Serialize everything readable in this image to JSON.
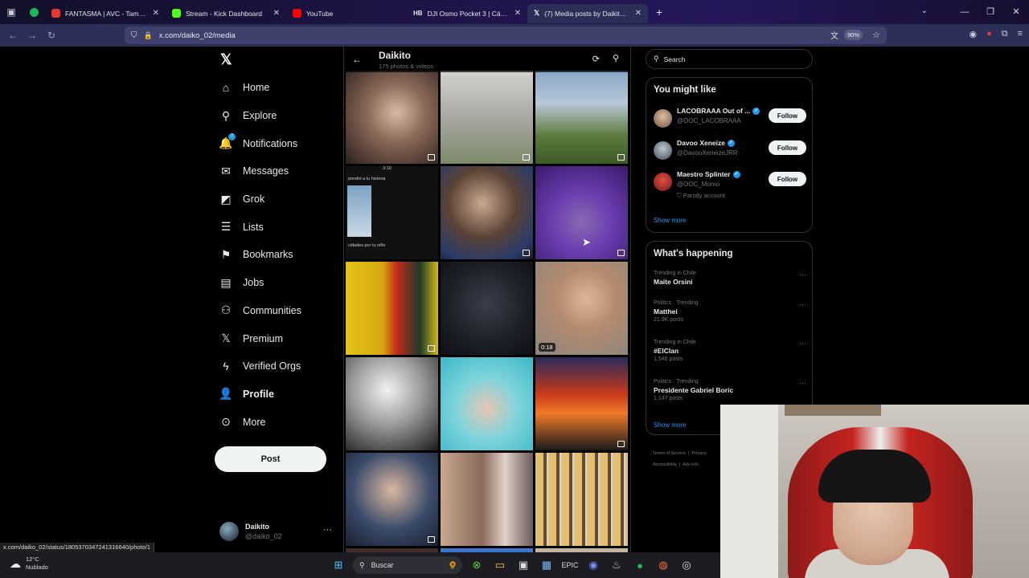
{
  "browser": {
    "tabs": [
      {
        "title": "FANTASMA | AVC - Tamy, Ji",
        "favicon_color": "#e53935"
      },
      {
        "title": "Stream - Kick Dashboard",
        "favicon_color": "#53fc18"
      },
      {
        "title": "YouTube",
        "favicon_color": "#ff0000"
      },
      {
        "title": "DJI Osmo Pocket 3 | Cámara de",
        "favicon_color": "#111111"
      },
      {
        "title": "(7) Media posts by Daikito (@da",
        "favicon_color": "#000000"
      }
    ],
    "tab_prefix_hb": "HB",
    "url": "x.com/daiko_02/media",
    "zoom": "90%"
  },
  "left_nav": {
    "items": [
      {
        "label": "Home",
        "icon": "home-icon",
        "glyph": "⌂"
      },
      {
        "label": "Explore",
        "icon": "search-icon",
        "glyph": "⚲"
      },
      {
        "label": "Notifications",
        "icon": "bell-icon",
        "glyph": "🔔"
      },
      {
        "label": "Messages",
        "icon": "mail-icon",
        "glyph": "✉"
      },
      {
        "label": "Grok",
        "icon": "grok-icon",
        "glyph": "◩"
      },
      {
        "label": "Lists",
        "icon": "list-icon",
        "glyph": "☰"
      },
      {
        "label": "Bookmarks",
        "icon": "bookmark-icon",
        "glyph": "🔖"
      },
      {
        "label": "Jobs",
        "icon": "briefcase-icon",
        "glyph": "💼"
      },
      {
        "label": "Communities",
        "icon": "communities-icon",
        "glyph": "👥"
      },
      {
        "label": "Premium",
        "icon": "x-premium-icon",
        "glyph": "𝕏"
      },
      {
        "label": "Verified Orgs",
        "icon": "lightning-icon",
        "glyph": "⚡"
      },
      {
        "label": "Profile",
        "icon": "person-icon",
        "glyph": "👤"
      },
      {
        "label": "More",
        "icon": "more-circle-icon",
        "glyph": "⋯"
      }
    ],
    "notification_badge": "7",
    "post_label": "Post",
    "account": {
      "name": "Daikito",
      "handle": "@daiko_02"
    }
  },
  "profile_header": {
    "name": "Daikito",
    "subtitle": "175 photos & videos"
  },
  "media": {
    "video_duration": "0:18",
    "story_text_top": "3:19",
    "story_text_mid": "pondió a tu historia",
    "story_text_bottom": "cidades por tu niño"
  },
  "right": {
    "search_placeholder": "Search",
    "wtf_title": "You might like",
    "suggestions": [
      {
        "name": "LACOBRAAA Out of ...",
        "handle": "@OOC_LACOBRAAA",
        "follow": "Follow"
      },
      {
        "name": "Davoo Xeneize",
        "handle": "@DavooXeneizeJRR",
        "follow": "Follow"
      },
      {
        "name": "Maestro Splinter",
        "handle": "@OOC_Momo",
        "follow": "Follow",
        "label": "Parody account"
      }
    ],
    "show_more": "Show more",
    "happening_title": "What's happening",
    "trends": [
      {
        "context": "Trending in Chile",
        "name": "Maite Orsini",
        "count": ""
      },
      {
        "context": "Politics · Trending",
        "name": "Matthei",
        "count": "21.9K posts"
      },
      {
        "context": "Trending in Chile",
        "name": "#ElClan",
        "count": "1,546 posts"
      },
      {
        "context": "Politics · Trending",
        "name": "Presidente Gabriel Boric",
        "count": "1,147 posts"
      }
    ],
    "footer": {
      "terms": "Terms of Service",
      "privacy": "Privacy",
      "accessibility": "Accessibility",
      "ads": "Ads info"
    }
  },
  "status_url": "x.com/daiko_02/status/1805370347241316640/photo/1",
  "taskbar": {
    "temp": "12°C",
    "condition": "Nublado",
    "search": "Buscar"
  }
}
